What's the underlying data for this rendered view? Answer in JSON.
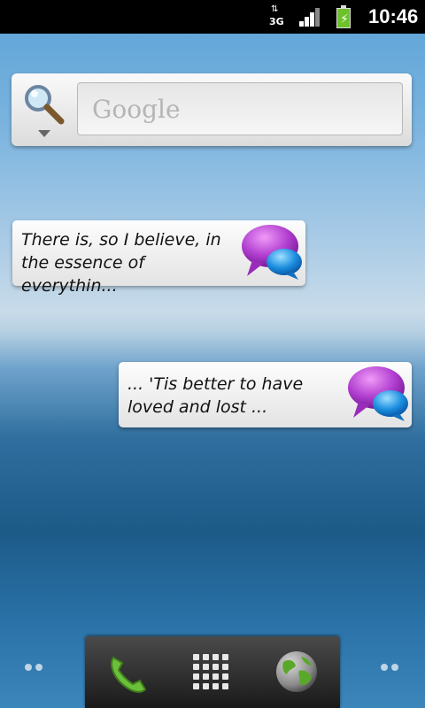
{
  "status_bar": {
    "network_type": "3G",
    "network_arrows": "⇅",
    "time": "10:46",
    "icons": [
      "data-activity-icon",
      "signal-strength-icon",
      "battery-charging-icon"
    ]
  },
  "search_widget": {
    "placeholder": "Google",
    "icon": "search-icon"
  },
  "quotes": [
    {
      "text": "There is, so I believe, in\nthe essence of everythin...",
      "icon": "message-bubbles-icon"
    },
    {
      "text": "... 'Tis better to have\nloved and lost ...",
      "icon": "message-bubbles-icon"
    }
  ],
  "dock": {
    "items": [
      "phone-icon",
      "app-drawer-icon",
      "browser-globe-icon"
    ]
  },
  "colors": {
    "status_bar": "#000000",
    "battery": "#6dc22a",
    "bubble_purple": "#b13fd0",
    "bubble_blue": "#1d8fe0",
    "phone_green": "#6bbf3a"
  }
}
